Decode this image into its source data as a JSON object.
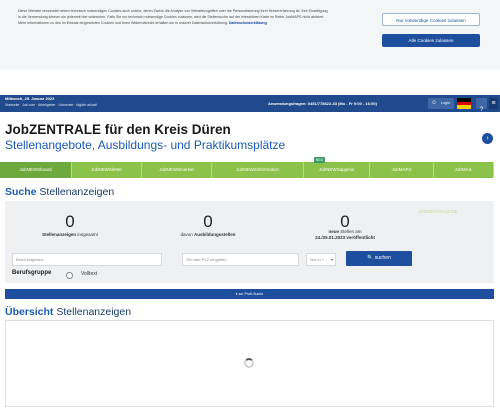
{
  "cookie": {
    "text": "Diese Website verwendet neben technisch notwendigen Cookies auch solche, deren Zweck die Analyse von Websitezugriffen oder die Personalisierung Ihrer Nutzererfahrung ist. Ihre Einwilligung in die Verwendung können sie jederzeit hier widerrufen. Falls Sie nur technisch notwendige Cookies zulassen, wird die Stellensuche auf der interaktiven Karte im Reiter JobMAPS nicht aktiviert. Mehr Informationen zu den im Einsatz eingesetzten Cookies und Ihren Widerrufsrecht erhalten sie in unserer Datenschutzerklärung.",
    "link_label": "Datenschutzerklärung",
    "btn_necessary": "Nur notwendige Cookies zulassen",
    "btn_all": "Alle Cookies zulassen"
  },
  "topbar": {
    "date": "Mittwoch, 25. Januar 2023",
    "subnav": "Startseite · Job.com · Arbeitgeber · Jobcenter · täglich aktuell",
    "hotline": "Anwendungsfragen: 0451/778622-33 (Mo - Fr 9:00 - 16:00)",
    "login_label": "Login",
    "user_icon": "user-icon",
    "help_icon": "help-icon",
    "menu_icon": "menu-icon",
    "flag_colors": [
      "#000000",
      "#dd0000",
      "#ffce00"
    ]
  },
  "heading": {
    "title": "JobZENTRALE für den Kreis Düren",
    "subtitle": "Stellenangebote, Ausbildungs- und Praktikumsplätze",
    "next_icon": "chevron-right-icon"
  },
  "nav": {
    "tabs": [
      "JobNEWSboard",
      "JobNEWSletter",
      "JobNEWSmarket",
      "JobNEWSinformation",
      "JobNEWSappmix",
      "JobMAPS",
      "JobMAIL"
    ],
    "new_badge": "NEU"
  },
  "search": {
    "title_bold": "Suche",
    "title_rest": " Stellenanzeigen",
    "counts": [
      {
        "value": "0",
        "label_bold": "Stellenanzeigen",
        "label_rest": " insgesamt",
        "label2": ""
      },
      {
        "value": "0",
        "label_bold": "",
        "label_rest": "davon ",
        "label_bold2": "Ausbildungsstellen",
        "label2": ""
      },
      {
        "value": "0",
        "label_bold": "neue",
        "label_rest": " Stellen am",
        "label2": "24./25.01.2023 veröffentlicht"
      }
    ],
    "watermark": "JOBZENTRALE.DE",
    "beruf_placeholder": "Beruf eingeben",
    "ort_placeholder": "Ort oder PLZ eingeben",
    "radius_value": "Nur in +",
    "search_label": "suchen",
    "search_icon": "search-icon",
    "berufsgruppe_label": "Berufsgruppe",
    "volltext_label": "Volltext"
  },
  "expand_bar": "▾  zur Profi-Suche",
  "overview": {
    "title_bold": "Übersicht",
    "title_rest": " Stellenanzeigen"
  }
}
